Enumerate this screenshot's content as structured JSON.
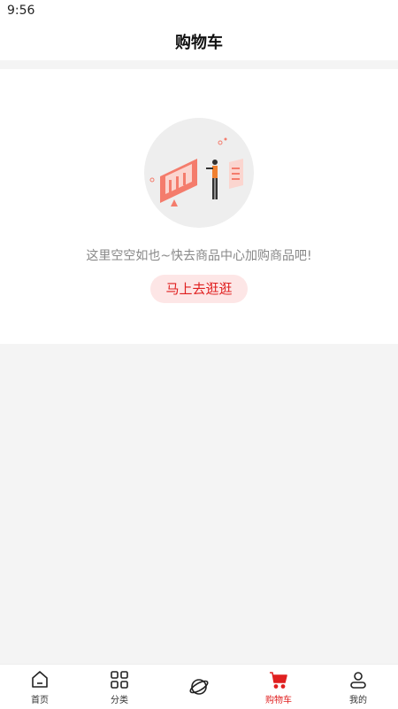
{
  "status_bar": {
    "time": "9:56"
  },
  "header": {
    "title": "购物车"
  },
  "empty_state": {
    "message": "这里空空如也~快去商品中心加购商品吧!",
    "button_label": "马上去逛逛"
  },
  "tabbar": {
    "items": [
      {
        "label": "首页",
        "icon": "home-icon"
      },
      {
        "label": "分类",
        "icon": "grid-icon"
      },
      {
        "label": "",
        "icon": "planet-icon"
      },
      {
        "label": "购物车",
        "icon": "cart-icon",
        "active": true
      },
      {
        "label": "我的",
        "icon": "user-icon"
      }
    ]
  },
  "colors": {
    "accent": "#e02020",
    "accent_soft_bg": "#fde6e6",
    "page_bg": "#f4f4f4"
  }
}
